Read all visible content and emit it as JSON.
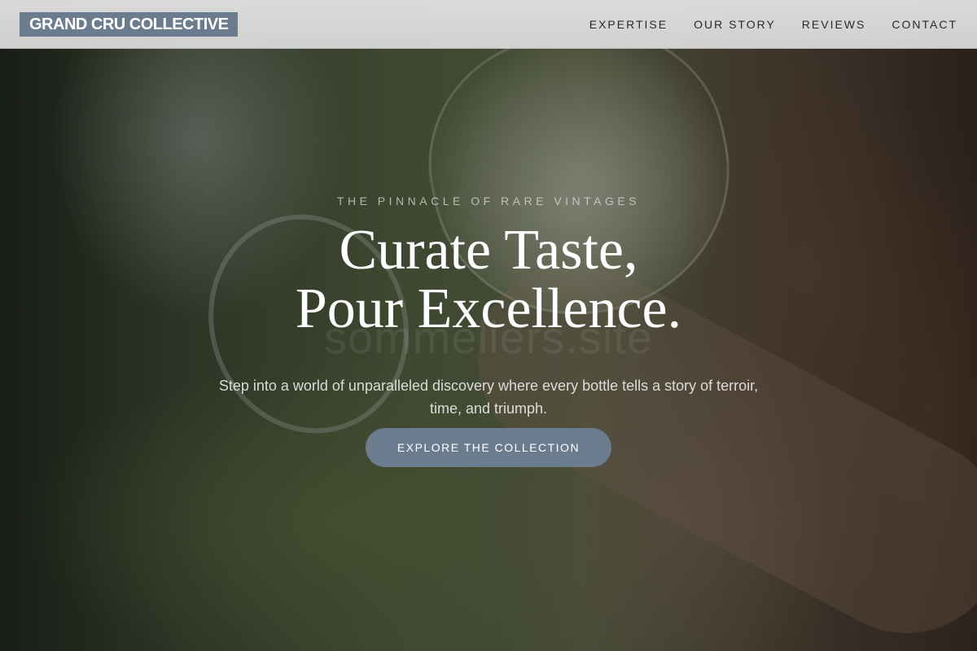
{
  "header": {
    "logo": "GRAND CRU COLLECTIVE",
    "nav": [
      {
        "label": "EXPERTISE"
      },
      {
        "label": "OUR STORY"
      },
      {
        "label": "REVIEWS"
      },
      {
        "label": "CONTACT"
      }
    ]
  },
  "hero": {
    "eyebrow": "THE PINNACLE OF RARE VINTAGES",
    "title_line1": "Curate Taste,",
    "title_line2": "Pour Excellence.",
    "watermark": "sommeliers.site",
    "subtitle": "Step into a world of unparalleled discovery where every bottle tells a story of terroir, time, and triumph.",
    "cta_label": "EXPLORE THE COLLECTION"
  },
  "colors": {
    "accent": "#6c7c8f",
    "header_bg": "#dcdcdc",
    "title_text": "#ffffff"
  }
}
